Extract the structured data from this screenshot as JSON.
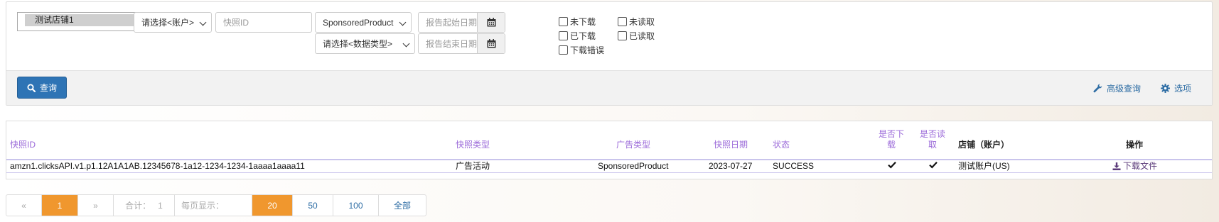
{
  "filters": {
    "shop_option": "测试店铺1",
    "account_placeholder": "请选择<账户>",
    "snapshot_id_placeholder": "快照ID",
    "sponsored_type": "SponsoredProduct",
    "data_type_placeholder": "请选择<数据类型>",
    "start_date_placeholder": "报告起始日期",
    "end_date_placeholder": "报告结束日期",
    "checkboxes": {
      "not_downloaded": "未下载",
      "downloaded": "已下载",
      "download_error": "下载错误",
      "not_read": "未读取",
      "read": "已读取"
    },
    "query_label": "查询",
    "advanced_query_label": "高级查询",
    "options_label": "选项"
  },
  "table": {
    "columns": {
      "snapshot_id": "快照ID",
      "snapshot_type": "快照类型",
      "ad_type": "广告类型",
      "snapshot_date": "快照日期",
      "status": "状态",
      "downloaded": "是否下载",
      "read": "是否读取",
      "shop_account": "店铺（账户）",
      "actions": "操作"
    },
    "rows": [
      {
        "snapshot_id": "amzn1.clicksAPI.v1.p1.12A1A1AB.12345678-1a12-1234-1234-1aaaa1aaaa11",
        "snapshot_type": "广告活动",
        "ad_type": "SponsoredProduct",
        "snapshot_date": "2023-07-27",
        "status": "SUCCESS",
        "downloaded": true,
        "read": true,
        "shop_account": "测试账户(US)",
        "action_label": "下载文件"
      }
    ]
  },
  "pagination": {
    "prev": "«",
    "current": "1",
    "next": "»",
    "total_label": "合计：",
    "total": "1",
    "per_page_label": "每页显示：",
    "sizes": [
      "20",
      "50",
      "100",
      "全部"
    ],
    "active_size": "20"
  },
  "colors": {
    "primary": "#2e74b5",
    "accent_orange": "#f0972e",
    "header_purple": "#9b6ad9",
    "link_blue": "#2e6da4"
  },
  "icons": {
    "query": "search-icon",
    "advanced": "wrench-icon",
    "options": "gear-icon",
    "date": "calendar-icon",
    "download": "download-icon",
    "check": "check-icon"
  }
}
